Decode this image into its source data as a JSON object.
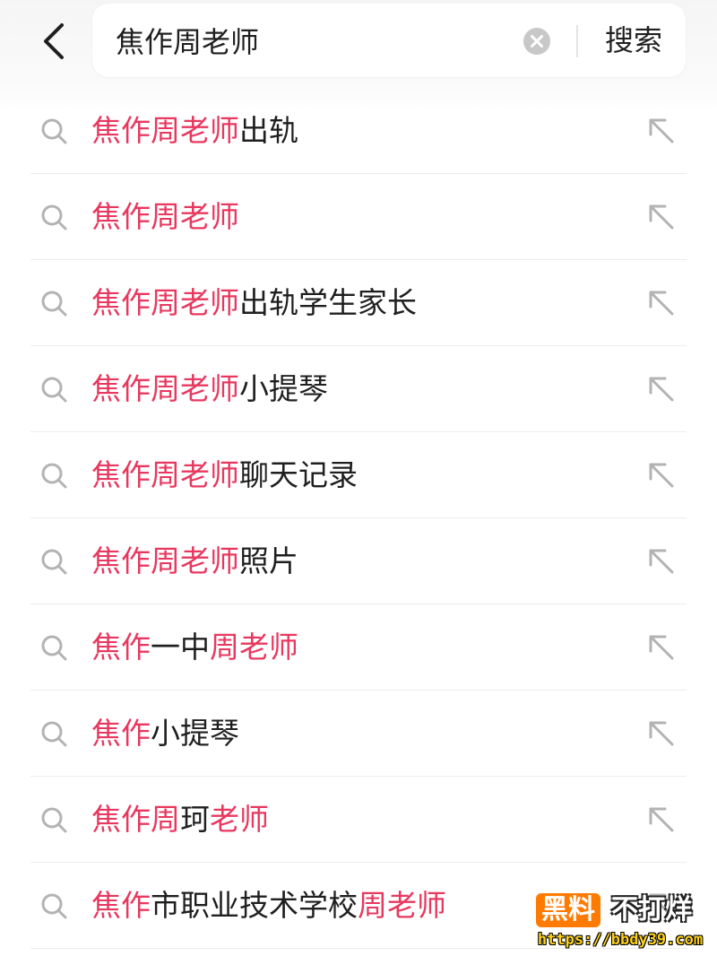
{
  "header": {
    "back_icon": "chevron-left-icon",
    "search": {
      "value": "焦作周老师",
      "clear_icon": "clear-circle-icon",
      "button_label": "搜索"
    }
  },
  "colors": {
    "highlight": "#e8385f",
    "text": "#1f1f1f",
    "icon": "#b3b3b3",
    "watermark_badge": "#ff7a00",
    "watermark_url": "#ffd21a"
  },
  "suggestions": [
    {
      "parts": [
        {
          "text": "焦作周老师",
          "hl": true
        },
        {
          "text": "出轨",
          "hl": false
        }
      ]
    },
    {
      "parts": [
        {
          "text": "焦作周老师",
          "hl": true
        }
      ]
    },
    {
      "parts": [
        {
          "text": "焦作周老师",
          "hl": true
        },
        {
          "text": "出轨学生家长",
          "hl": false
        }
      ]
    },
    {
      "parts": [
        {
          "text": "焦作周老师",
          "hl": true
        },
        {
          "text": "小提琴",
          "hl": false
        }
      ]
    },
    {
      "parts": [
        {
          "text": "焦作周老师",
          "hl": true
        },
        {
          "text": "聊天记录",
          "hl": false
        }
      ]
    },
    {
      "parts": [
        {
          "text": "焦作周老师",
          "hl": true
        },
        {
          "text": "照片",
          "hl": false
        }
      ]
    },
    {
      "parts": [
        {
          "text": "焦作",
          "hl": true
        },
        {
          "text": "一中",
          "hl": false
        },
        {
          "text": "周老师",
          "hl": true
        }
      ]
    },
    {
      "parts": [
        {
          "text": "焦作",
          "hl": true
        },
        {
          "text": "小提琴",
          "hl": false
        }
      ]
    },
    {
      "parts": [
        {
          "text": "焦作周",
          "hl": true
        },
        {
          "text": "珂",
          "hl": false
        },
        {
          "text": "老师",
          "hl": true
        }
      ]
    },
    {
      "parts": [
        {
          "text": "焦作",
          "hl": true
        },
        {
          "text": "市职业技术学校",
          "hl": false
        },
        {
          "text": "周老师",
          "hl": true
        }
      ]
    }
  ],
  "suggestion_icons": {
    "leading": "search-icon",
    "trailing": "arrow-up-left-icon"
  },
  "watermark": {
    "badge": "黑料",
    "text": "不打烊",
    "url": "https://bbdy39.com"
  }
}
